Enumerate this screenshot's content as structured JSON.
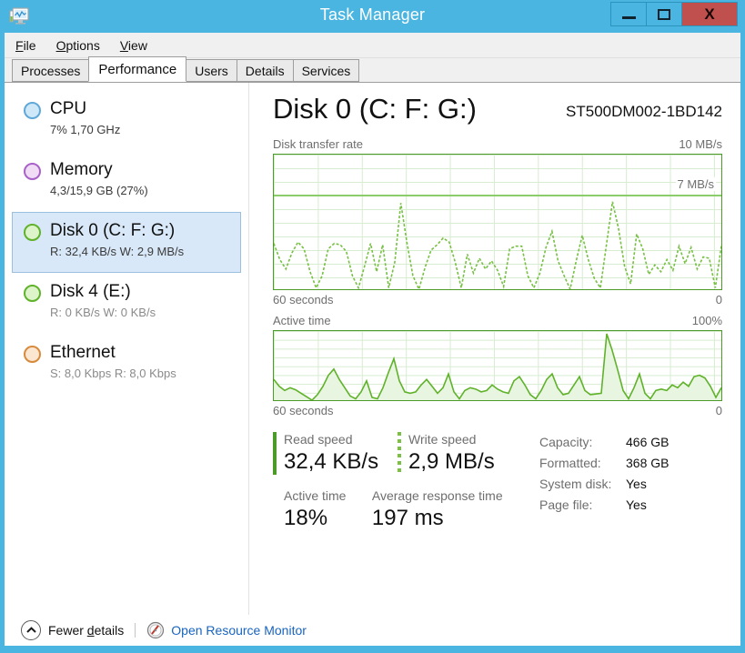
{
  "window": {
    "title": "Task Manager",
    "icon": "task-manager-monitor-icon",
    "minimize_label": "Minimize",
    "maximize_label": "Maximize",
    "close_label": "X",
    "frame_color": "#4ab5e0",
    "close_color": "#c0504d"
  },
  "menu": [
    {
      "label": "File",
      "accel": "F"
    },
    {
      "label": "Options",
      "accel": "O"
    },
    {
      "label": "View",
      "accel": "V"
    }
  ],
  "tabs": [
    {
      "label": "Processes",
      "active": false
    },
    {
      "label": "Performance",
      "active": true
    },
    {
      "label": "Users",
      "active": false
    },
    {
      "label": "Details",
      "active": false
    },
    {
      "label": "Services",
      "active": false
    }
  ],
  "sidebar": {
    "items": [
      {
        "name": "CPU",
        "detail": "7%  1,70 GHz",
        "dot_color": "#cfe8f7",
        "dot_border": "#5fa8d8",
        "selected": false,
        "dim": false
      },
      {
        "name": "Memory",
        "detail": "4,3/15,9 GB (27%)",
        "dot_color": "#f0dcf5",
        "dot_border": "#a861c8",
        "selected": false,
        "dim": false
      },
      {
        "name": "Disk 0 (C: F: G:)",
        "detail": "R: 32,4 KB/s  W: 2,9 MB/s",
        "dot_color": "#ddf3c9",
        "dot_border": "#5fb22a",
        "selected": true,
        "dim": false
      },
      {
        "name": "Disk 4 (E:)",
        "detail": "R: 0 KB/s  W: 0 KB/s",
        "dot_color": "#ddf3c9",
        "dot_border": "#5fb22a",
        "selected": false,
        "dim": true
      },
      {
        "name": "Ethernet",
        "detail": "S: 8,0 Kbps  R: 8,0 Kbps",
        "dot_color": "#fbe6d2",
        "dot_border": "#d88a3c",
        "selected": false,
        "dim": true
      }
    ]
  },
  "main": {
    "title": "Disk 0 (C: F: G:)",
    "model": "ST500DM002-1BD142",
    "graph1": {
      "label": "Disk transfer rate",
      "max_label": "10 MB/s",
      "threshold_label": "7 MB/s",
      "x_left": "60 seconds",
      "x_right": "0"
    },
    "graph2": {
      "label": "Active time",
      "max_label": "100%",
      "x_left": "60 seconds",
      "x_right": "0"
    },
    "stats": {
      "read_speed_label": "Read speed",
      "read_speed_value": "32,4 KB/s",
      "write_speed_label": "Write speed",
      "write_speed_value": "2,9 MB/s",
      "active_time_label": "Active time",
      "active_time_value": "18%",
      "avg_response_label": "Average response time",
      "avg_response_value": "197 ms"
    },
    "properties": [
      {
        "key": "Capacity:",
        "value": "466 GB"
      },
      {
        "key": "Formatted:",
        "value": "368 GB"
      },
      {
        "key": "System disk:",
        "value": "Yes"
      },
      {
        "key": "Page file:",
        "value": "Yes"
      }
    ]
  },
  "footer": {
    "fewer_details": "Fewer details",
    "fewer_icon": "chevron-up-icon",
    "resource_monitor": "Open Resource Monitor",
    "resource_icon": "resource-monitor-icon",
    "link_color": "#1764c0"
  },
  "chart_data": [
    {
      "type": "line",
      "title": "Disk transfer rate",
      "ylabel": "MB/s",
      "xlabel": "seconds",
      "ylim": [
        0,
        10
      ],
      "xlim": [
        60,
        0
      ],
      "threshold": 7,
      "threshold_label": "7 MB/s",
      "grid": true,
      "style": "dashed",
      "color": "#77c044",
      "values": [
        3.4,
        2.2,
        1.5,
        2.7,
        3.5,
        3.0,
        1.3,
        0.1,
        1.0,
        3.0,
        3.4,
        3.3,
        2.8,
        1.0,
        0.1,
        1.7,
        3.4,
        1.3,
        3.3,
        0.1,
        2.0,
        6.4,
        3.5,
        1.0,
        0.0,
        1.6,
        2.9,
        3.3,
        3.8,
        3.5,
        2.0,
        0.1,
        2.6,
        1.2,
        2.3,
        1.5,
        2.1,
        1.4,
        0.2,
        3.0,
        3.2,
        3.2,
        1.0,
        0.1,
        1.2,
        3.1,
        4.3,
        2.1,
        1.0,
        0.0,
        2.1,
        4.0,
        2.2,
        0.8,
        0.1,
        3.3,
        6.5,
        4.5,
        1.7,
        0.4,
        4.1,
        3.0,
        1.1,
        1.8,
        1.3,
        2.2,
        1.4,
        3.2,
        1.9,
        3.1,
        1.5,
        2.4,
        2.3,
        0.1,
        3.2
      ]
    },
    {
      "type": "area",
      "title": "Active time",
      "ylabel": "%",
      "xlabel": "seconds",
      "ylim": [
        0,
        100
      ],
      "xlim": [
        60,
        0
      ],
      "grid": true,
      "style": "solid-filled",
      "color": "#5fb22a",
      "fill": "#e8f5e0",
      "values": [
        30,
        20,
        14,
        18,
        15,
        10,
        5,
        0,
        8,
        20,
        36,
        45,
        30,
        18,
        6,
        2,
        12,
        28,
        4,
        2,
        18,
        40,
        60,
        28,
        12,
        10,
        12,
        22,
        30,
        20,
        10,
        18,
        38,
        12,
        2,
        14,
        18,
        16,
        12,
        14,
        22,
        16,
        12,
        10,
        28,
        34,
        22,
        8,
        2,
        14,
        30,
        38,
        18,
        8,
        10,
        22,
        34,
        14,
        8,
        9,
        10,
        96,
        72,
        44,
        14,
        2,
        18,
        38,
        10,
        2,
        14,
        16,
        14,
        22,
        18,
        26,
        20,
        34,
        36,
        32,
        20,
        4,
        18
      ]
    }
  ]
}
